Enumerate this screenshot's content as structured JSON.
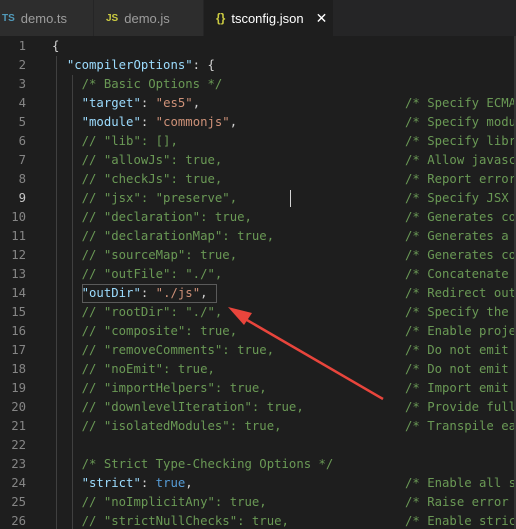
{
  "tabs": [
    {
      "icon": "TS",
      "label": "demo.ts"
    },
    {
      "icon": "JS",
      "label": "demo.js"
    },
    {
      "icon": "{}",
      "label": "tsconfig.json",
      "close": "✕"
    }
  ],
  "lines": [
    {
      "n": "1",
      "code": "{"
    },
    {
      "n": "2",
      "code": "  \"compilerOptions\": {"
    },
    {
      "n": "3",
      "code": "    /* Basic Options */"
    },
    {
      "n": "4",
      "code": "    \"target\": \"es5\",",
      "comment": "/* Specify ECMA"
    },
    {
      "n": "5",
      "code": "    \"module\": \"commonjs\",",
      "comment": "/* Specify modu"
    },
    {
      "n": "6",
      "code": "    // \"lib\": [],",
      "comment": "/* Specify libr"
    },
    {
      "n": "7",
      "code": "    // \"allowJs\": true,",
      "comment": "/* Allow javasc"
    },
    {
      "n": "8",
      "code": "    // \"checkJs\": true,",
      "comment": "/* Report error"
    },
    {
      "n": "9",
      "code": "    // \"jsx\": \"preserve\",",
      "comment": "/* Specify JSX"
    },
    {
      "n": "10",
      "code": "    // \"declaration\": true,",
      "comment": "/* Generates co"
    },
    {
      "n": "11",
      "code": "    // \"declarationMap\": true,",
      "comment": "/* Generates a"
    },
    {
      "n": "12",
      "code": "    // \"sourceMap\": true,",
      "comment": "/* Generates co"
    },
    {
      "n": "13",
      "code": "    // \"outFile\": \"./\",",
      "comment": "/* Concatenate"
    },
    {
      "n": "14",
      "code": "    \"outDir\": \"./js\",",
      "comment": "/* Redirect out"
    },
    {
      "n": "15",
      "code": "    // \"rootDir\": \"./\",",
      "comment": "/* Specify the"
    },
    {
      "n": "16",
      "code": "    // \"composite\": true,",
      "comment": "/* Enable proje"
    },
    {
      "n": "17",
      "code": "    // \"removeComments\": true,",
      "comment": "/* Do not emit"
    },
    {
      "n": "18",
      "code": "    // \"noEmit\": true,",
      "comment": "/* Do not emit"
    },
    {
      "n": "19",
      "code": "    // \"importHelpers\": true,",
      "comment": "/* Import emit"
    },
    {
      "n": "20",
      "code": "    // \"downlevelIteration\": true,",
      "comment": "/* Provide full"
    },
    {
      "n": "21",
      "code": "    // \"isolatedModules\": true,",
      "comment": "/* Transpile ea"
    },
    {
      "n": "22",
      "code": ""
    },
    {
      "n": "23",
      "code": "    /* Strict Type-Checking Options */"
    },
    {
      "n": "24",
      "code": "    \"strict\": true,",
      "comment": "/* Enable all s"
    },
    {
      "n": "25",
      "code": "    // \"noImplicitAny\": true,",
      "comment": "/* Raise error"
    },
    {
      "n": "26",
      "code": "    // \"strictNullChecks\": true,",
      "comment": "/* Enable stric"
    }
  ],
  "current_line": "9",
  "arrow_color": "#e8453c"
}
